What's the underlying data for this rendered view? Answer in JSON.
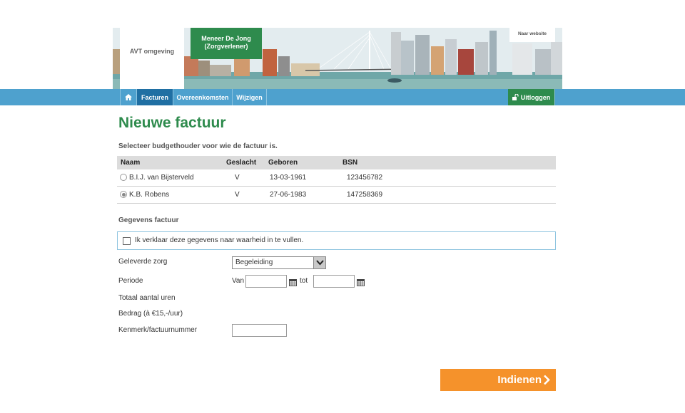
{
  "header": {
    "environment_label": "AVT omgeving",
    "user_name": "Meneer De Jong",
    "user_role": "(Zorgverlener)",
    "website_link": "Naar website"
  },
  "nav": {
    "home_icon": "home-icon",
    "items": [
      "Facturen",
      "Overeenkomsten",
      "Wijzigen"
    ],
    "active": "Facturen",
    "logout": "Uitloggen",
    "logout_icon": "unlock-icon"
  },
  "page": {
    "title": "Nieuwe factuur",
    "instruction": "Selecteer budgethouder voor wie de factuur is."
  },
  "table": {
    "headers": [
      "Naam",
      "Geslacht",
      "Geboren",
      "BSN"
    ],
    "rows": [
      {
        "naam": "B.I.J. van Bijsterveld",
        "geslacht": "V",
        "geboren": "13-03-1961",
        "bsn": "123456782",
        "selected": false
      },
      {
        "naam": "K.B. Robens",
        "geslacht": "V",
        "geboren": "27-06-1983",
        "bsn": "147258369",
        "selected": true
      }
    ]
  },
  "form": {
    "section_title": "Gegevens factuur",
    "declaration": "Ik verklaar deze gegevens naar waarheid in te vullen.",
    "declaration_checked": false,
    "geleverde_zorg_label": "Geleverde zorg",
    "geleverde_zorg_value": "Begeleiding",
    "periode_label": "Periode",
    "van_label": "Van",
    "tot_label": "tot",
    "van_value": "",
    "tot_value": "",
    "totaal_uren_label": "Totaal aantal uren",
    "bedrag_label": "Bedrag (à €15,-/uur)",
    "kenmerk_label": "Kenmerk/factuurnummer",
    "kenmerk_value": ""
  },
  "actions": {
    "submit_label": "Indienen"
  },
  "colors": {
    "brand_green": "#2e8b4d",
    "nav_blue": "#4ea1ce",
    "nav_active": "#1f6fa3",
    "submit_orange": "#f5922b"
  }
}
